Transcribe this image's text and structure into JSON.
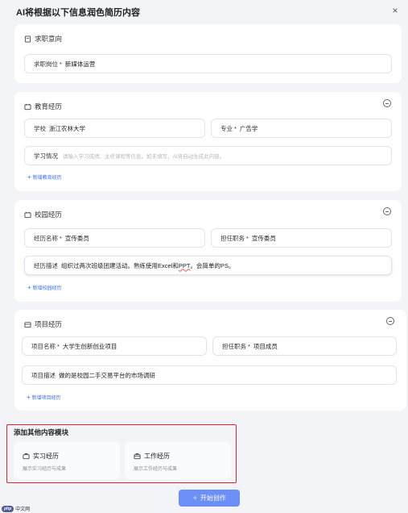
{
  "header": {
    "title": "AI将根据以下信息润色简历内容",
    "close": "×"
  },
  "job_intention": {
    "title": "求职意向",
    "position": {
      "label": "求职岗位",
      "value": "新媒体运营"
    }
  },
  "education": {
    "title": "教育经历",
    "school": {
      "label": "学校",
      "value": "浙江农林大学"
    },
    "major": {
      "label": "专业",
      "value": "广告学"
    },
    "study": {
      "label": "学习情况",
      "placeholder": "请输入学习成绩、主修课程等信息。如未填写，AI将自动生成此内容。"
    },
    "add": "新增教育经历"
  },
  "campus": {
    "title": "校园经历",
    "name": {
      "label": "经历名称",
      "value": "宣传委员"
    },
    "role": {
      "label": "担任职务",
      "value": "宣传委员"
    },
    "desc": {
      "label": "经历描述",
      "value_a": "组织过两次班级团建活动。熟练使用Excel和",
      "value_b": "PPT",
      "value_c": "。会简单的PS。"
    },
    "add": "新增校园经历"
  },
  "project": {
    "title": "项目经历",
    "name": {
      "label": "项目名称",
      "value": "大学生创新创业项目"
    },
    "role": {
      "label": "担任职务",
      "value": "项目成员"
    },
    "desc": {
      "label": "项目描述",
      "value": "做的是校园二手交易平台的市场调研"
    },
    "add": "新增项目经历"
  },
  "more_modules": {
    "title": "添加其他内容模块",
    "internship": {
      "title": "实习经历",
      "desc": "展示实习经历与成果"
    },
    "work": {
      "title": "工作经历",
      "desc": "展示工作经历与成果"
    }
  },
  "start_button": "开始创作",
  "watermark": {
    "logo": "php",
    "text": "中文网"
  },
  "colors": {
    "accent": "#3d6ef5",
    "button": "#6b8ef7",
    "highlight": "#e0222e"
  }
}
